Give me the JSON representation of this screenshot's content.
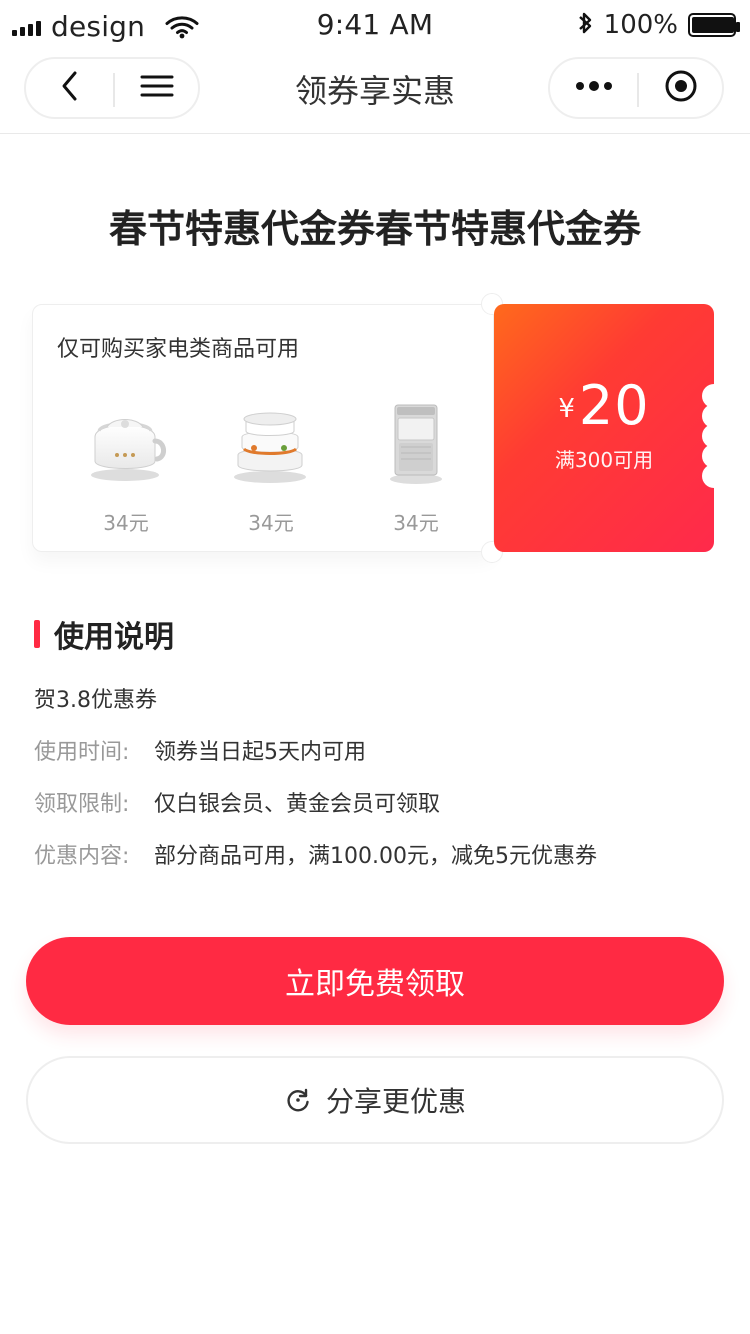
{
  "status_bar": {
    "carrier": "design",
    "time": "9:41 AM",
    "battery_percent": "100%",
    "battery_level": 1.0,
    "icons": [
      "signal-icon",
      "wifi-icon",
      "bluetooth-icon",
      "battery-icon"
    ]
  },
  "nav": {
    "title": "领券享实惠",
    "left_icons": [
      "back-icon",
      "menu-icon"
    ],
    "right_icons": [
      "more-icon",
      "target-icon"
    ]
  },
  "coupon": {
    "title": "春节特惠代金券春节特惠代金券",
    "availability": "仅可购买家电类商品可用",
    "products": [
      {
        "name": "electric-cooker",
        "price": "34元"
      },
      {
        "name": "multi-layer-steamer",
        "price": "34元"
      },
      {
        "name": "washing-machine",
        "price": "34元"
      }
    ],
    "currency_symbol": "¥",
    "amount": "20",
    "condition": "满300可用",
    "colors": {
      "gradient_start": "#ff6a1c",
      "gradient_mid": "#ff3b33",
      "gradient_end": "#ff2a4b"
    }
  },
  "usage": {
    "section_title": "使用说明",
    "headline": "贺3.8优惠券",
    "rows": [
      {
        "label": "使用时间:",
        "value": "领券当日起5天内可用"
      },
      {
        "label": "领取限制:",
        "value": "仅白银会员、黄金会员可领取"
      },
      {
        "label": "优惠内容:",
        "value": "部分商品可用，满100.00元，减免5元优惠券"
      }
    ]
  },
  "actions": {
    "primary_label": "立即免费领取",
    "secondary_label": "分享更优惠",
    "secondary_icon": "refresh-icon",
    "brand_color": "#ff2a43"
  }
}
